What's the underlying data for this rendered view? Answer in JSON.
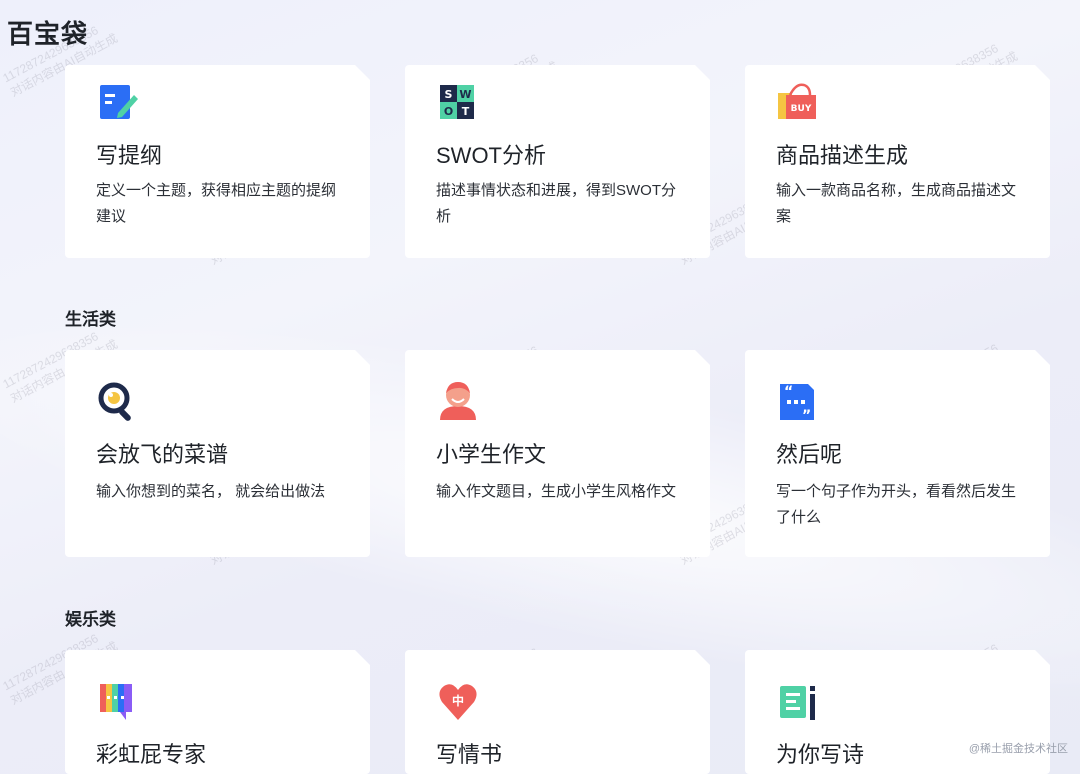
{
  "page_title": "百宝袋",
  "sections": [
    {
      "title": "生活类"
    },
    {
      "title": "娱乐类"
    }
  ],
  "cards": [
    {
      "name": "写提纲",
      "desc": "定义一个主题，获得相应主题的提纲建议",
      "icon": "edit-doc-icon"
    },
    {
      "name": "SWOT分析",
      "desc": "描述事情状态和进展，得到SWOT分析",
      "icon": "swot-icon",
      "icon_letters": [
        "S",
        "W",
        "O",
        "T"
      ]
    },
    {
      "name": "商品描述生成",
      "desc": "输入一款商品名称，生成商品描述文案",
      "icon": "shopping-bag-icon",
      "icon_text": "BUY"
    },
    {
      "name": "会放飞的菜谱",
      "desc": "输入你想到的菜名， 就会给出做法",
      "icon": "magnifier-egg-icon"
    },
    {
      "name": "小学生作文",
      "desc": "输入作文题目，生成小学生风格作文",
      "icon": "student-avatar-icon"
    },
    {
      "name": "然后呢",
      "desc": "写一个句子作为开头，看看然后发生了什么",
      "icon": "quote-bubble-icon"
    },
    {
      "name": "彩虹屁专家",
      "desc": "",
      "icon": "rainbow-chat-icon"
    },
    {
      "name": "写情书",
      "desc": "",
      "icon": "heart-icon",
      "icon_text": "中"
    },
    {
      "name": "为你写诗",
      "desc": "",
      "icon": "poem-pen-icon"
    }
  ],
  "watermark": {
    "line1": "11728724296383​56",
    "line2": "对话内容由AI自动生成"
  },
  "corner_tag": "@稀土掘金技术社区",
  "colors": {
    "blue": "#2b6ef5",
    "teal": "#4fd1a5",
    "red": "#ef5f5a",
    "yellow": "#f5c542",
    "navy": "#1e2a4a"
  }
}
